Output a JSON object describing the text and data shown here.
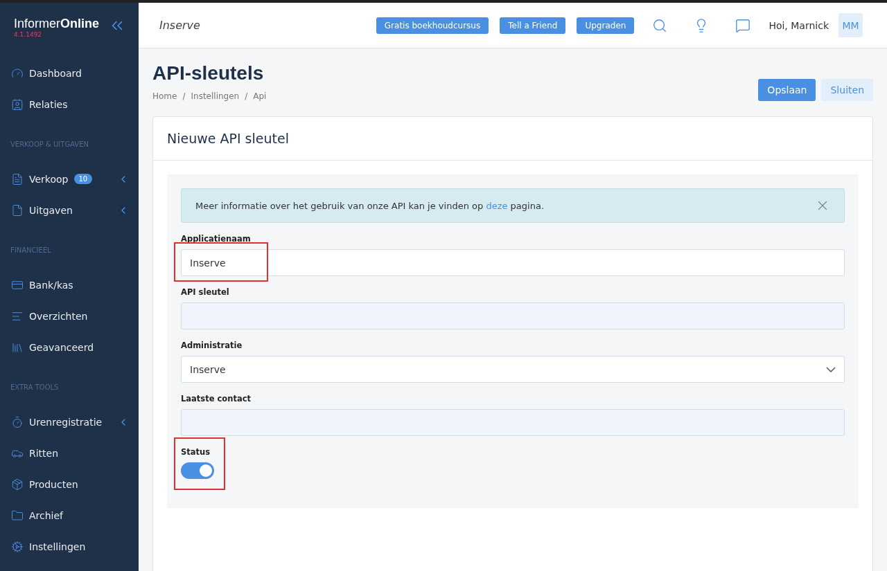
{
  "sidebar": {
    "logo": {
      "name_light": "Informer",
      "name_bold": "Online",
      "version": "4.1.1492"
    },
    "sections": [
      {
        "items": [
          {
            "label": "Dashboard",
            "submenu": false
          },
          {
            "label": "Relaties",
            "submenu": false
          }
        ]
      },
      {
        "title": "VERKOOP & UITGAVEN",
        "items": [
          {
            "label": "Verkoop",
            "badge": "10",
            "submenu": true
          },
          {
            "label": "Uitgaven",
            "submenu": true
          }
        ]
      },
      {
        "title": "FINANCIEEL",
        "items": [
          {
            "label": "Bank/kas",
            "submenu": false
          },
          {
            "label": "Overzichten",
            "submenu": false
          },
          {
            "label": "Geavanceerd",
            "submenu": false
          }
        ]
      },
      {
        "title": "EXTRA TOOLS",
        "items": [
          {
            "label": "Urenregistratie",
            "submenu": true
          },
          {
            "label": "Ritten",
            "submenu": false
          },
          {
            "label": "Producten",
            "submenu": false
          },
          {
            "label": "Archief",
            "submenu": false
          },
          {
            "label": "Instellingen",
            "submenu": false
          }
        ]
      }
    ]
  },
  "header": {
    "company": "Inserve",
    "buttons": [
      "Gratis boekhoudcursus",
      "Tell a Friend",
      "Upgraden"
    ],
    "greeting": "Hoi, Marnick",
    "avatar": "MM"
  },
  "page": {
    "title": "API-sleutels",
    "breadcrumb": [
      "Home",
      "Instellingen",
      "Api"
    ],
    "breadcrumb_separator": "/",
    "actions": [
      {
        "label": "Opslaan",
        "kind": "primary"
      },
      {
        "label": "Sluiten",
        "kind": "secondary"
      }
    ]
  },
  "card": {
    "title": "Nieuwe API sleutel",
    "alert": {
      "text_before": "Meer informatie over het gebruik van onze API kan je vinden op",
      "link": "deze",
      "text_after": "pagina."
    },
    "fields": [
      {
        "kind": "text",
        "label": "Applicatienaam",
        "value": "Inserve",
        "highlighted": true
      },
      {
        "kind": "readonly",
        "label": "API sleutel",
        "highlighted": false
      },
      {
        "kind": "select",
        "label": "Administratie",
        "value": "Inserve",
        "highlighted": false
      },
      {
        "kind": "readonly",
        "label": "Laatste contact",
        "highlighted": false
      },
      {
        "kind": "toggle",
        "label": "Status",
        "on": true,
        "highlighted": true
      }
    ]
  }
}
